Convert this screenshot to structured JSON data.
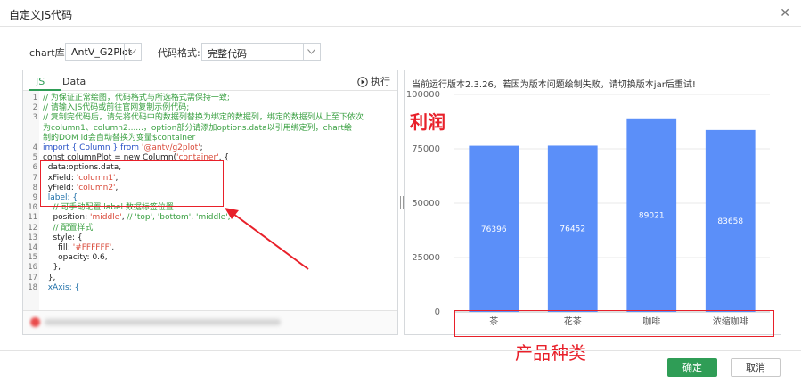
{
  "dialog": {
    "title": "自定义JS代码"
  },
  "options": {
    "chart_lib_label": "chart库:",
    "chart_lib_value": "AntV_G2Plot",
    "code_format_label": "代码格式:",
    "code_format_value": "完整代码"
  },
  "editor": {
    "tabs": [
      {
        "label": "JS"
      },
      {
        "label": "Data"
      }
    ],
    "run_label": "执行",
    "line_numbers": [
      "1",
      "2",
      "3",
      "",
      "",
      "4",
      "5",
      "6",
      "7",
      "8",
      "9",
      "10",
      "11",
      "12",
      "13",
      "14",
      "15",
      "16",
      "17",
      "18"
    ],
    "code": {
      "l1": "// 为保证正常绘图，代码格式与所选格式需保持一致;",
      "l2": "// 请输入JS代码或前往官网复制示例代码;",
      "l3a": "// 复制完代码后，请先将代码中的数据列替换为绑定的数据列，绑定的数据列从上至下依次",
      "l3b": "为column1、column2......，option部分请添加options.data以引用绑定列，chart绘",
      "l3c": "制的DOM id会自动替换为变量$container",
      "l4_pre": "import { Column } from ",
      "l4_str": "'@antv/g2plot'",
      "l4_end": ";",
      "l5_pre": "const columnPlot = new Column(",
      "l5_str": "'container'",
      "l5_end": ", {",
      "l6": "  data:options.data,",
      "l7_pre": "  xField: ",
      "l7_str": "'column1'",
      "l7_end": ",",
      "l8_pre": "  yField: ",
      "l8_str": "'column2'",
      "l8_end": ",",
      "l9": "  label: {",
      "l10": "    // 可手动配置 label 数据标签位置",
      "l11_pre": "    position: ",
      "l11_str": "'middle'",
      "l11_mid": ", ",
      "l11_cm": "// 'top', 'bottom', 'middle',",
      "l12": "    // 配置样式",
      "l13": "    style: {",
      "l14_pre": "      fill: ",
      "l14_str": "'#FFFFFF'",
      "l14_end": ",",
      "l15": "      opacity: 0.6,",
      "l16": "    },",
      "l17": "  },",
      "l18": "  xAxis: {"
    }
  },
  "preview": {
    "notice": "当前运行版本2.3.26，若因为版本问题绘制失败，请切换版本jar后重试!"
  },
  "annotations": {
    "y_text": "利润",
    "x_text": "产品种类"
  },
  "chart_data": {
    "type": "bar",
    "categories": [
      "茶",
      "花茶",
      "咖啡",
      "浓缩咖啡"
    ],
    "values": [
      76396,
      76452,
      89021,
      83658
    ],
    "value_labels": [
      "76396",
      "76452",
      "89021",
      "83658"
    ],
    "ylim": [
      0,
      100000
    ],
    "y_ticks": [
      "0",
      "25000",
      "50000",
      "75000",
      "100000"
    ],
    "y_tick_values": [
      0,
      25000,
      50000,
      75000,
      100000
    ],
    "color": "#5b8ff9",
    "grid": true
  },
  "buttons": {
    "ok": "确定",
    "cancel": "取消"
  },
  "colors": {
    "accent": "#2f9d56",
    "annotation": "#e8202a",
    "bar": "#5b8ff9"
  }
}
